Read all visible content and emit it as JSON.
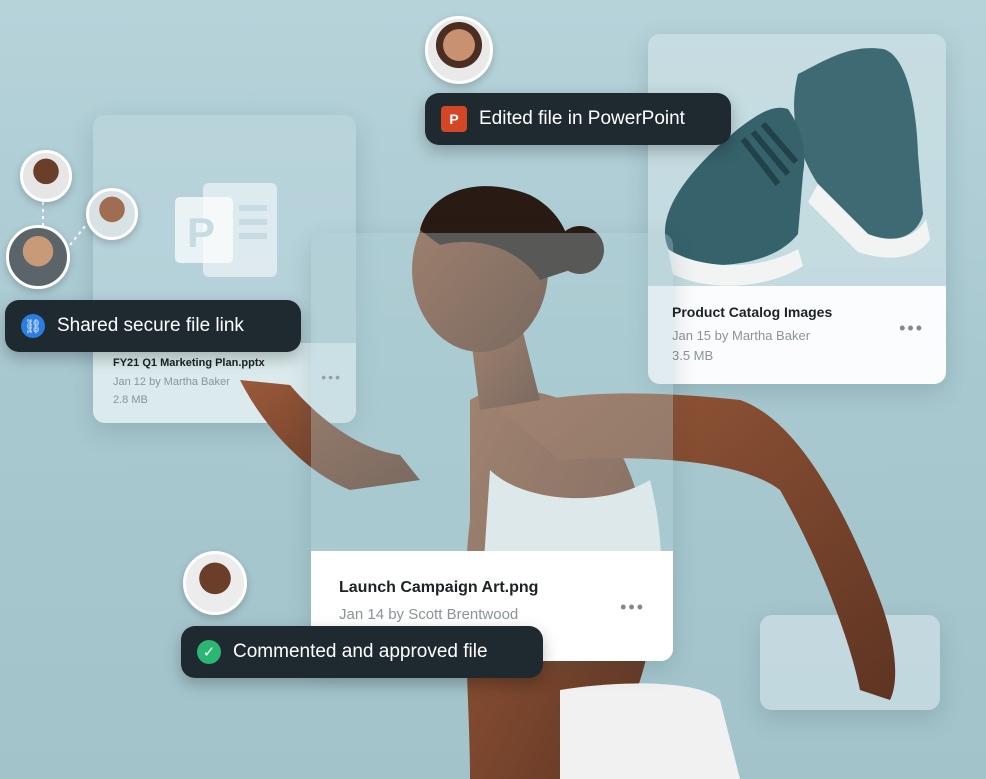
{
  "colors": {
    "dark_pill": "#1f2a30",
    "link_blue": "#2a7de1",
    "check_green": "#2bb673",
    "ppt_red": "#d24726"
  },
  "marketing_card": {
    "title": "FY21 Q1 Marketing Plan.pptx",
    "date_author": "Jan 12 by Martha Baker",
    "size": "2.8 MB",
    "more": "•••"
  },
  "catalog_card": {
    "title": "Product Catalog Images",
    "date_author": "Jan 15 by Martha Baker",
    "size": "3.5 MB",
    "more": "•••"
  },
  "campaign_card": {
    "title": "Launch Campaign Art.png",
    "date_author": "Jan 14 by Scott Brentwood",
    "more": "•••"
  },
  "pills": {
    "shared": "Shared secure file link",
    "edited": "Edited file in PowerPoint",
    "commented": "Commented and approved file"
  },
  "icons": [
    "powerpoint-icon",
    "link-icon",
    "check-icon",
    "more-icon",
    "avatar"
  ]
}
